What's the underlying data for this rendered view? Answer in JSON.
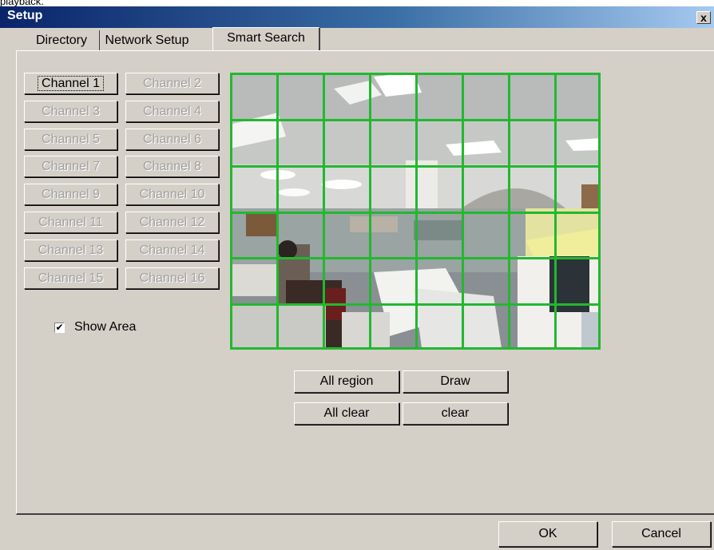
{
  "clipped_text": "playback.",
  "window": {
    "title": "Setup",
    "close_glyph": "x"
  },
  "tabs": [
    {
      "label": "Directory",
      "active": false
    },
    {
      "label": "Network Setup",
      "active": false
    },
    {
      "label": "Smart Search",
      "active": true
    }
  ],
  "channels": [
    {
      "label": "Channel 1",
      "enabled": true,
      "focused": true
    },
    {
      "label": "Channel 2",
      "enabled": false
    },
    {
      "label": "Channel 3",
      "enabled": false
    },
    {
      "label": "Channel 4",
      "enabled": false
    },
    {
      "label": "Channel 5",
      "enabled": false
    },
    {
      "label": "Channel 6",
      "enabled": false
    },
    {
      "label": "Channel 7",
      "enabled": false
    },
    {
      "label": "Channel 8",
      "enabled": false
    },
    {
      "label": "Channel 9",
      "enabled": false
    },
    {
      "label": "Channel 10",
      "enabled": false
    },
    {
      "label": "Channel 11",
      "enabled": false
    },
    {
      "label": "Channel 12",
      "enabled": false
    },
    {
      "label": "Channel 13",
      "enabled": false
    },
    {
      "label": "Channel 14",
      "enabled": false
    },
    {
      "label": "Channel 15",
      "enabled": false
    },
    {
      "label": "Channel 16",
      "enabled": false
    }
  ],
  "show_area": {
    "label": "Show Area",
    "checked": true
  },
  "motion_grid": {
    "columns": 8,
    "rows": 6,
    "line_color": "#22b830"
  },
  "region_buttons": {
    "all_region": "All region",
    "draw": "Draw",
    "all_clear": "All clear",
    "clear": "clear"
  },
  "footer": {
    "ok": "OK",
    "cancel": "Cancel"
  }
}
